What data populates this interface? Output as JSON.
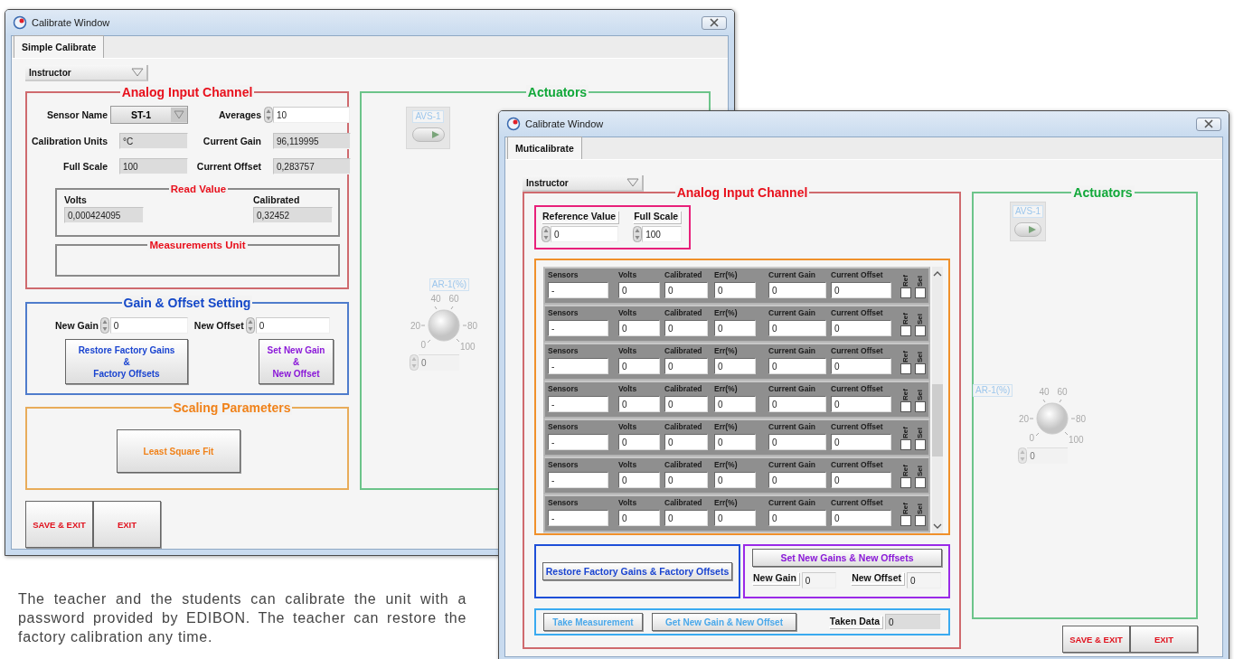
{
  "simple_window": {
    "title": "Calibrate Window",
    "tabs": [
      {
        "label": "Simple Calibrate",
        "selected": true
      }
    ],
    "user_select": "Instructor",
    "analog_input": {
      "title": "Analog Input Channel",
      "fields": [
        {
          "label": "Sensor Name",
          "value": "ST-1",
          "kind": "dropdown"
        },
        {
          "label": "Averages",
          "value": "10",
          "kind": "spinner"
        },
        {
          "label": "Calibration Units",
          "value": "°C",
          "kind": "readout"
        },
        {
          "label": "Current Gain",
          "value": "96,119995",
          "kind": "readout"
        },
        {
          "label": "Full Scale",
          "value": "100",
          "kind": "readout"
        },
        {
          "label": "Current Offset",
          "value": "0,283757",
          "kind": "readout"
        }
      ],
      "read_value": {
        "title": "Read Value",
        "readings": [
          {
            "label": "Volts",
            "value": "0,000424095"
          },
          {
            "label": "Calibrated",
            "value": "0,32452"
          }
        ]
      },
      "measurements_unit": {
        "title": "Measurements Unit"
      }
    },
    "gain_offset": {
      "title": "Gain & Offset Setting",
      "fields": [
        {
          "label": "New Gain",
          "value": "0"
        },
        {
          "label": "New Offset",
          "value": "0"
        }
      ],
      "buttons": [
        {
          "kind": "restore",
          "lines": [
            "Restore Factory Gains",
            "&",
            "Factory Offsets"
          ]
        },
        {
          "kind": "set",
          "lines": [
            "Set New Gain",
            "&",
            "New Offset"
          ]
        }
      ]
    },
    "scaling": {
      "title": "Scaling Parameters",
      "button": "Least Square Fit"
    },
    "actuators": {
      "title": "Actuators",
      "disabled": true,
      "valve": {
        "label": "AVS-1"
      },
      "dial": {
        "label": "AR-1(%)",
        "scale": [
          "0",
          "20",
          "40",
          "60",
          "80",
          "100"
        ],
        "value": "0"
      }
    },
    "buttons": [
      "SAVE & EXIT",
      "EXIT"
    ]
  },
  "multi_window": {
    "title": "Calibrate Window",
    "tabs": [
      {
        "label": "Muticalibrate",
        "selected": true
      }
    ],
    "user_select": "Instructor",
    "analog_input": {
      "title": "Analog Input Channel",
      "reference": [
        {
          "label": "Reference Value",
          "value": "0"
        },
        {
          "label": "Full Scale",
          "value": "100"
        }
      ],
      "sensors": [
        {
          "labels": [
            "Sensors",
            "Volts",
            "Calibrated",
            "Err(%)",
            "Current Gain",
            "Current Offset",
            "Ref",
            "Sel"
          ],
          "values": [
            "-",
            "0",
            "0",
            "0",
            "0",
            "0"
          ],
          "ref": false,
          "sel": false
        },
        {
          "labels": [
            "Sensors",
            "Volts",
            "Calibrated",
            "Err(%)",
            "Current Gain",
            "Current Offset",
            "Ref",
            "Sel"
          ],
          "values": [
            "-",
            "0",
            "0",
            "0",
            "0",
            "0"
          ],
          "ref": false,
          "sel": false
        },
        {
          "labels": [
            "Sensors",
            "Volts",
            "Calibrated",
            "Err(%)",
            "Current Gain",
            "Current Offset",
            "Ref",
            "Sel"
          ],
          "values": [
            "-",
            "0",
            "0",
            "0",
            "0",
            "0"
          ],
          "ref": false,
          "sel": false
        },
        {
          "labels": [
            "Sensors",
            "Volts",
            "Calibrated",
            "Err(%)",
            "Current Gain",
            "Current Offset",
            "Ref",
            "Sel"
          ],
          "values": [
            "-",
            "0",
            "0",
            "0",
            "0",
            "0"
          ],
          "ref": false,
          "sel": false
        },
        {
          "labels": [
            "Sensors",
            "Volts",
            "Calibrated",
            "Err(%)",
            "Current Gain",
            "Current Offset",
            "Ref",
            "Sel"
          ],
          "values": [
            "-",
            "0",
            "0",
            "0",
            "0",
            "0"
          ],
          "ref": false,
          "sel": false
        },
        {
          "labels": [
            "Sensors",
            "Volts",
            "Calibrated",
            "Err(%)",
            "Current Gain",
            "Current Offset",
            "Ref",
            "Sel"
          ],
          "values": [
            "-",
            "0",
            "0",
            "0",
            "0",
            "0"
          ],
          "ref": false,
          "sel": false
        },
        {
          "labels": [
            "Sensors",
            "Volts",
            "Calibrated",
            "Err(%)",
            "Current Gain",
            "Current Offset",
            "Ref",
            "Sel"
          ],
          "values": [
            "-",
            "0",
            "0",
            "0",
            "0",
            "0"
          ],
          "ref": false,
          "sel": false
        }
      ],
      "restore_button": "Restore Factory Gains & Factory Offsets",
      "set_gains": {
        "button": "Set New Gains & New Offsets",
        "fields": [
          {
            "label": "New Gain",
            "value": "0"
          },
          {
            "label": "New Offset",
            "value": "0"
          }
        ]
      },
      "measurement": {
        "buttons": [
          "Take Measurement",
          "Get New Gain & New Offset"
        ],
        "taken_label": "Taken Data",
        "taken_value": "0"
      }
    },
    "actuators": {
      "title": "Actuators",
      "disabled": true,
      "valve": {
        "label": "AVS-1"
      },
      "dial": {
        "label": "AR-1(%)",
        "scale": [
          "0",
          "20",
          "40",
          "60",
          "80",
          "100"
        ],
        "value": "0"
      }
    },
    "buttons": [
      "SAVE & EXIT",
      "EXIT"
    ]
  },
  "caption": "The teacher and the students can calibrate the unit with a password provided by EDIBON. The teacher can restore the factory calibration any time."
}
